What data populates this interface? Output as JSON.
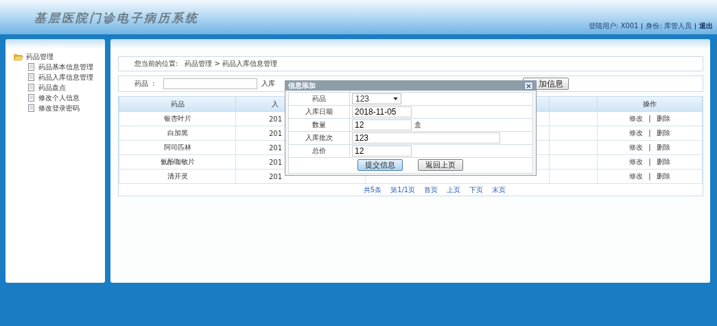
{
  "header": {
    "title": "基层医院门诊电子病历系统",
    "user_label": "登陆用户: X001",
    "role_label": "身份: 库管人员",
    "logout": "退出"
  },
  "sidebar": {
    "group": {
      "label": "药品管理",
      "expanded": true,
      "children": [
        {
          "label": "药品基本信息管理",
          "selected": false
        },
        {
          "label": "药品入库信息管理",
          "selected": false
        },
        {
          "label": "药品盘点",
          "selected": false
        },
        {
          "label": "修改个人信息",
          "selected": false
        },
        {
          "label": "修改登录密码",
          "selected": false
        }
      ]
    }
  },
  "breadcrumb": {
    "prefix": "您当前的位置:",
    "path": "药品管理 > 药品入库信息管理"
  },
  "search": {
    "fields": [
      {
        "label": "药品  :"
      },
      {
        "label": "入库"
      }
    ],
    "add_button": "加信息"
  },
  "table": {
    "columns": [
      "药品",
      "入",
      "",
      "",
      "操作"
    ],
    "rows": [
      {
        "cells": [
          "银杏叶片",
          "201"
        ],
        "actions": [
          "修改",
          "删除"
        ]
      },
      {
        "cells": [
          "白加黑",
          "201"
        ],
        "actions": [
          "修改",
          "删除"
        ]
      },
      {
        "cells": [
          "阿司匹林",
          "201"
        ],
        "actions": [
          "修改",
          "删除"
        ]
      },
      {
        "cells": [
          "氨酚咖敏片",
          "201"
        ],
        "actions": [
          "修改",
          "删除"
        ]
      },
      {
        "cells": [
          "清开灵",
          "201"
        ],
        "actions": [
          "修改",
          "删除"
        ]
      }
    ],
    "action_separator": "|",
    "pager": [
      "共5条",
      "第1/1页",
      "首页",
      "上页",
      "下页",
      "末页"
    ]
  },
  "dialog": {
    "title": "信息添加",
    "fields": [
      {
        "label": "药品",
        "kind": "select",
        "value": "123"
      },
      {
        "label": "入库日期",
        "kind": "text",
        "value": "2018-11-05"
      },
      {
        "label": "数量",
        "kind": "text",
        "value": "12",
        "unit": "盒"
      },
      {
        "label": "入库批次",
        "kind": "wide",
        "value": "123"
      },
      {
        "label": "总价",
        "kind": "text",
        "value": "12"
      }
    ],
    "buttons": [
      {
        "label": "提交信息",
        "primary": true
      },
      {
        "label": "返回上页",
        "primary": false
      }
    ]
  }
}
